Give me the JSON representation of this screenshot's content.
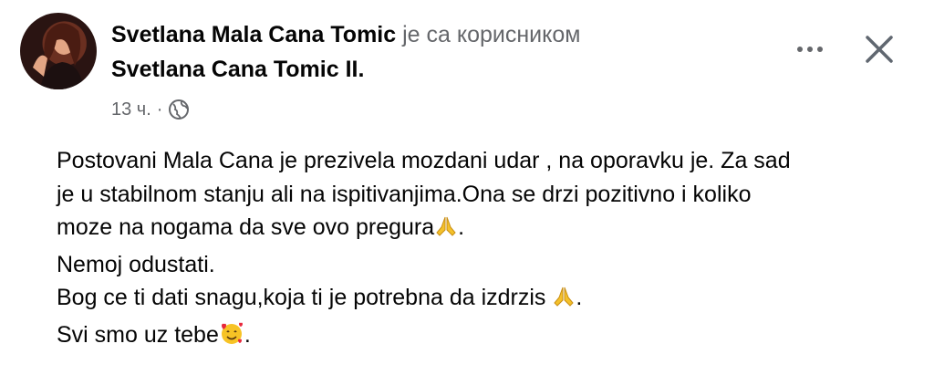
{
  "post": {
    "author": "Svetlana Mala Cana Tomic",
    "with_text": "је са корисником",
    "tagged_user": "Svetlana Cana Tomic II.",
    "tagged_suffix": ".",
    "timestamp": "13 ч.",
    "separator": "·",
    "privacy_icon": "globe-icon",
    "body": {
      "line1": "Postovani Mala Cana je prezivela mozdani udar , na oporavku je. Za sad",
      "line2": "je u stabilnom stanju ali na ispitivanjima.Ona se drzi pozitivno i koliko",
      "line3a": "moze na nogama da sve ovo pregura",
      "line3b": ".",
      "line4": "Nemoj odustati.",
      "line5a": "Bog ce ti dati snagu,koja ti je potrebna da izdrzis ",
      "line5b": ".",
      "line6a": "Svi smo uz tebe",
      "line6b": "."
    },
    "emojis": {
      "pray": "folded-hands-icon",
      "love": "smiling-face-with-hearts-icon"
    }
  },
  "colors": {
    "text_primary": "#050505",
    "text_secondary": "#65676b",
    "background": "#ffffff"
  }
}
